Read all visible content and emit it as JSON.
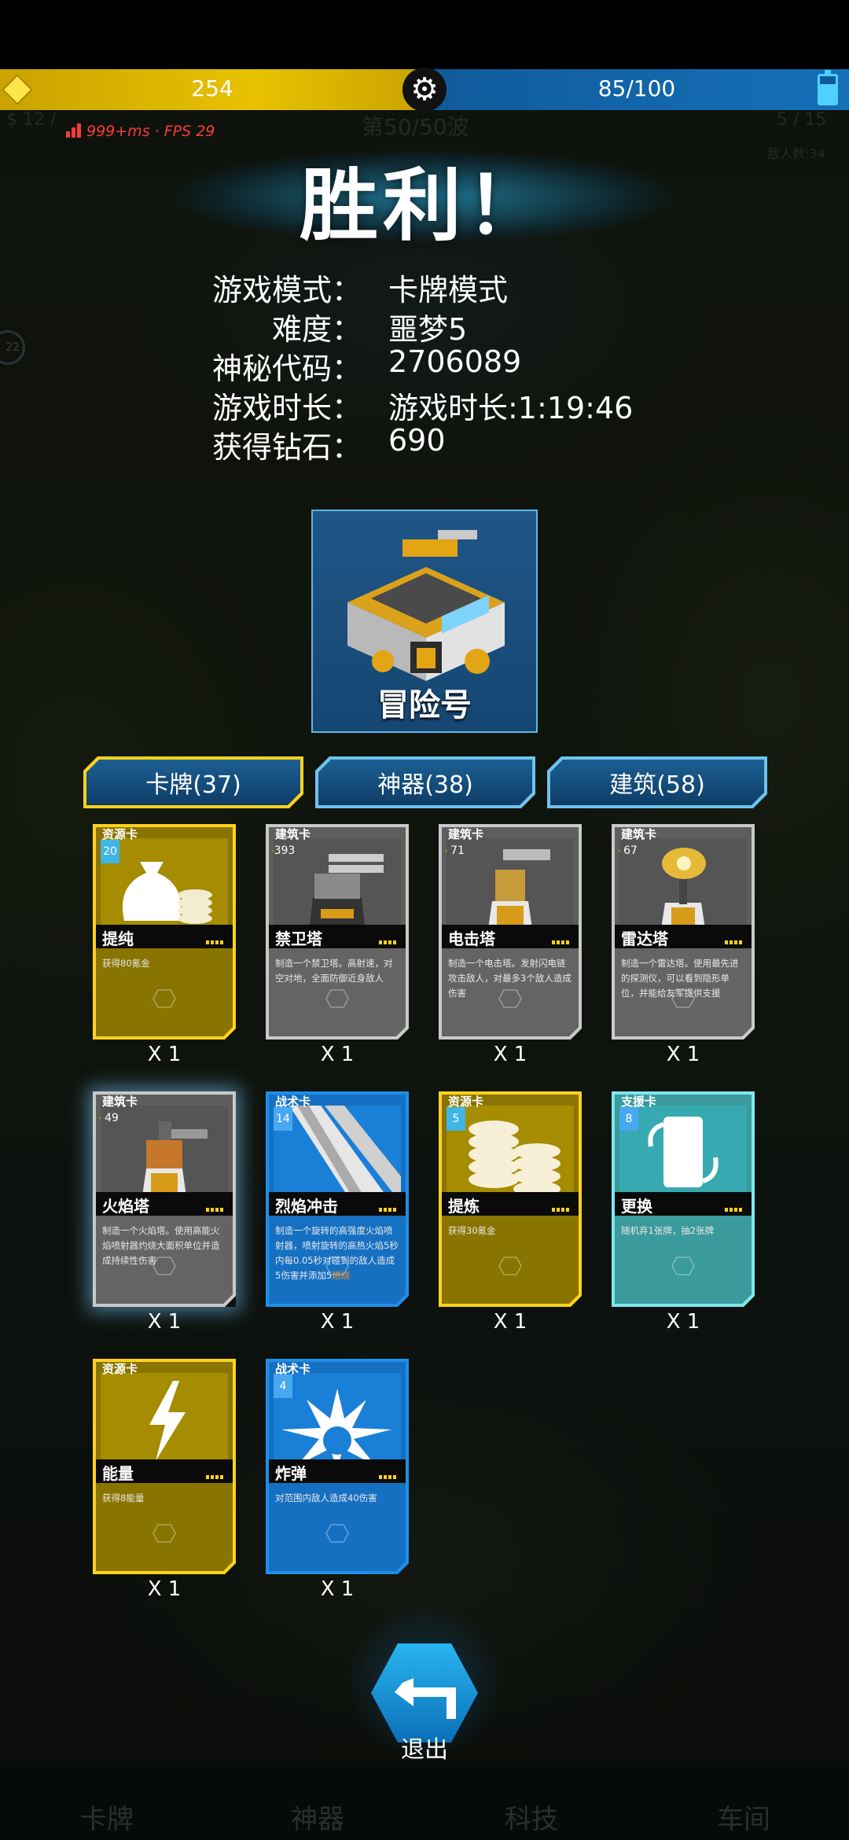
{
  "hud": {
    "gold": "254",
    "energy": "85/100",
    "fps": "999+ms · FPS 29",
    "wave": "第50/50波",
    "left_counter": "$ 12 /",
    "right_counter": "5 / 15",
    "enemies": "敌人数:34",
    "side_badge": "22"
  },
  "victory": {
    "title": "胜利！",
    "rows": [
      {
        "label": "游戏模式：",
        "value": "卡牌模式"
      },
      {
        "label": "难度：",
        "value": "噩梦5"
      },
      {
        "label": "神秘代码：",
        "value": "2706089"
      },
      {
        "label": "游戏时长：",
        "value": "游戏时长:1:19:46"
      },
      {
        "label": "获得钻石：",
        "value": "690"
      }
    ]
  },
  "ship": {
    "name": "冒险号"
  },
  "tabs": [
    {
      "label": "卡牌(37)",
      "active": true
    },
    {
      "label": "神器(38)",
      "active": false
    },
    {
      "label": "建筑(58)",
      "active": false
    }
  ],
  "cards": [
    {
      "type": "资源卡",
      "cost": "20",
      "name": "提纯",
      "desc": "获得80氪金",
      "qty": "X 1",
      "art": "money-bag-icon"
    },
    {
      "type": "建筑卡",
      "cost": "393",
      "name": "禁卫塔",
      "desc": "制造一个禁卫塔。高射速，对空对地，全面防御近身敌人",
      "qty": "X 1",
      "art": "turret-icon"
    },
    {
      "type": "建筑卡",
      "cost": "71",
      "name": "电击塔",
      "desc": "制造一个电击塔。发射闪电链攻击敌人，对最多3个敌人造成伤害",
      "qty": "X 1",
      "art": "tesla-tower-icon"
    },
    {
      "type": "建筑卡",
      "cost": "67",
      "name": "雷达塔",
      "desc": "制造一个雷达塔。使用最先进的探测仪，可以看到隐形单位，并能给友军提供支援",
      "qty": "X 1",
      "art": "radar-tower-icon"
    },
    {
      "type": "建筑卡",
      "cost": "49",
      "name": "火焰塔",
      "desc": "制造一个火焰塔。使用高能火焰喷射器灼烧大面积单位并造成持续性伤害",
      "qty": "X 1",
      "art": "flame-tower-icon"
    },
    {
      "type": "战术卡",
      "cost": "14",
      "name": "烈焰冲击",
      "desc": "制造一个旋转的高强度火焰喷射器，喷射旋转的高热火焰5秒内每0.05秒对碰到的敌人造成5伤害并添加5",
      "desc_hl": "燃烧",
      "qty": "X 1",
      "art": "flame-blades-icon"
    },
    {
      "type": "资源卡",
      "cost": "5",
      "name": "提炼",
      "desc": "获得30氪金",
      "qty": "X 1",
      "art": "coin-stacks-icon"
    },
    {
      "type": "支援卡",
      "cost": "8",
      "name": "更换",
      "desc": "随机弃1张牌，抽2张牌",
      "qty": "X 1",
      "art": "swap-card-icon"
    },
    {
      "type": "资源卡",
      "cost": "",
      "name": "能量",
      "desc": "获得8能量",
      "qty": "X 1",
      "art": "lightning-icon"
    },
    {
      "type": "战术卡",
      "cost": "4",
      "name": "炸弹",
      "desc": "对范围内敌人造成40伤害",
      "qty": "X 1",
      "art": "explosion-icon"
    }
  ],
  "exit": {
    "label": "退出"
  },
  "bottom_nav": [
    "卡牌",
    "神器",
    "科技",
    "车间"
  ]
}
